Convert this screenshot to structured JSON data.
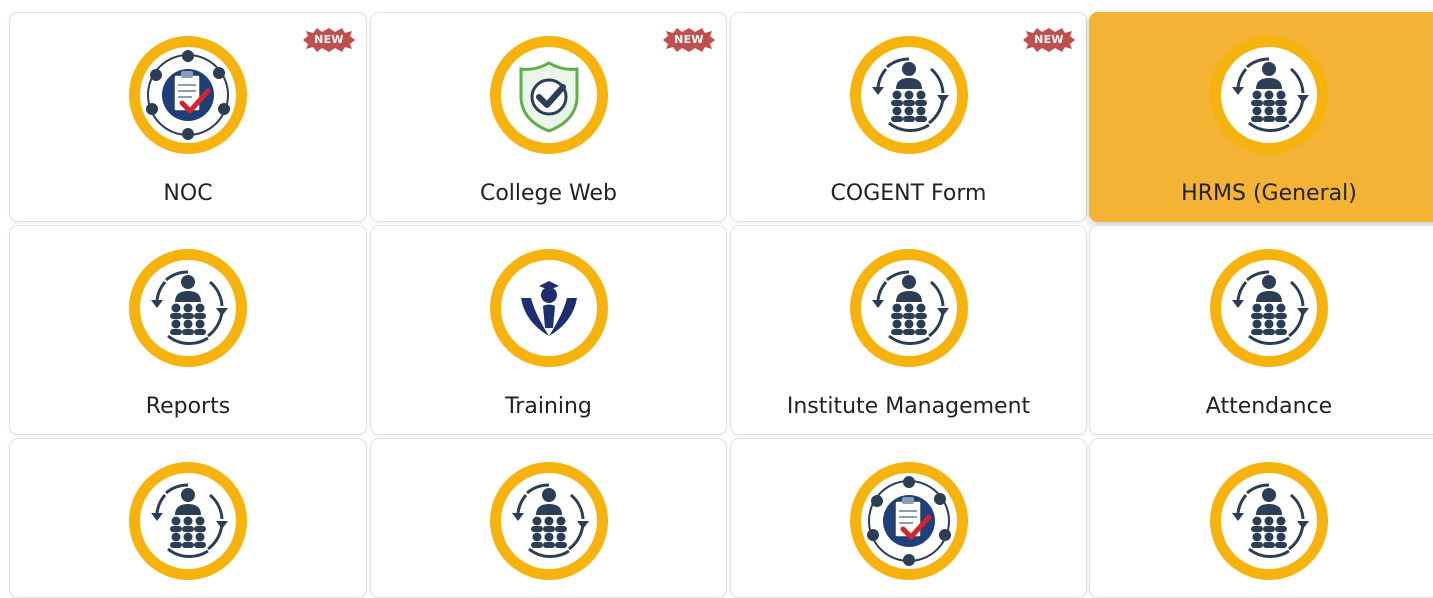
{
  "colors": {
    "accent": "#f5b335",
    "ring": "#f6b20d",
    "icon_dark": "#2c3e56",
    "badge": "#c0504d"
  },
  "tiles": [
    {
      "label": "NOC",
      "icon": "noc-clipboard-icon",
      "badge": "NEW",
      "active": false
    },
    {
      "label": "College Web",
      "icon": "shield-check-icon",
      "badge": "NEW",
      "active": false
    },
    {
      "label": "COGENT Form",
      "icon": "people-cycle-icon",
      "badge": "NEW",
      "active": false
    },
    {
      "label": "HRMS (General)",
      "icon": "people-cycle-icon",
      "active": true
    },
    {
      "label": "Reports",
      "icon": "people-cycle-icon",
      "active": false
    },
    {
      "label": "Training",
      "icon": "graduate-hands-icon",
      "active": false
    },
    {
      "label": "Institute Management",
      "icon": "people-cycle-icon",
      "active": false
    },
    {
      "label": "Attendance",
      "icon": "people-cycle-icon",
      "active": false
    },
    {
      "icon": "people-cycle-icon",
      "active": false
    },
    {
      "icon": "people-cycle-icon",
      "active": false
    },
    {
      "icon": "noc-clipboard-icon",
      "active": false
    },
    {
      "icon": "people-cycle-icon",
      "active": false
    }
  ]
}
